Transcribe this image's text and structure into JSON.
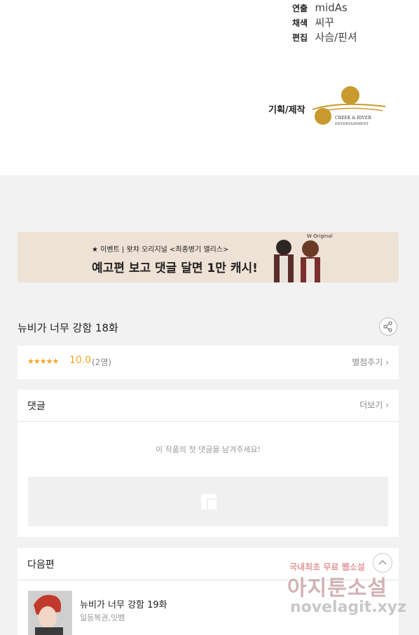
{
  "credits": [
    {
      "label": "연출",
      "value": "midAs"
    },
    {
      "label": "채색",
      "value": "씨꾸"
    },
    {
      "label": "편집",
      "value": "사슴/핀셔"
    }
  ],
  "planning_label": "기획/제작",
  "logo_text": "CREEK & RIVER ENTERTAINMENT",
  "banner": {
    "small_text": "★ 이벤트 | 왓챠 오리지널 <최종병기 앨리스>",
    "big_text": "예고편 보고 댓글 달면 1만 캐시!",
    "badge": "W Original"
  },
  "episode": {
    "title": "뉴비가 너무 강함 18화"
  },
  "rating": {
    "stars": "★★★★★",
    "score": "10.0",
    "count": "(2명)",
    "rate_label": "별점주기"
  },
  "comments": {
    "title": "댓글",
    "more_label": "더보기",
    "empty_message": "이 작품의 첫 댓글을 남겨주세요!"
  },
  "next": {
    "title": "다음편",
    "episode_title": "뉴비가 너무 강함 19화",
    "authors": "일등복권,잇뱀"
  },
  "watermark": {
    "line1": "국내최초 무료 웹소설",
    "line2": "아지툰소설",
    "line3": "novelagit.xyz"
  },
  "colors": {
    "accent": "#f5a623",
    "banner_bg": "#eee1d5"
  }
}
